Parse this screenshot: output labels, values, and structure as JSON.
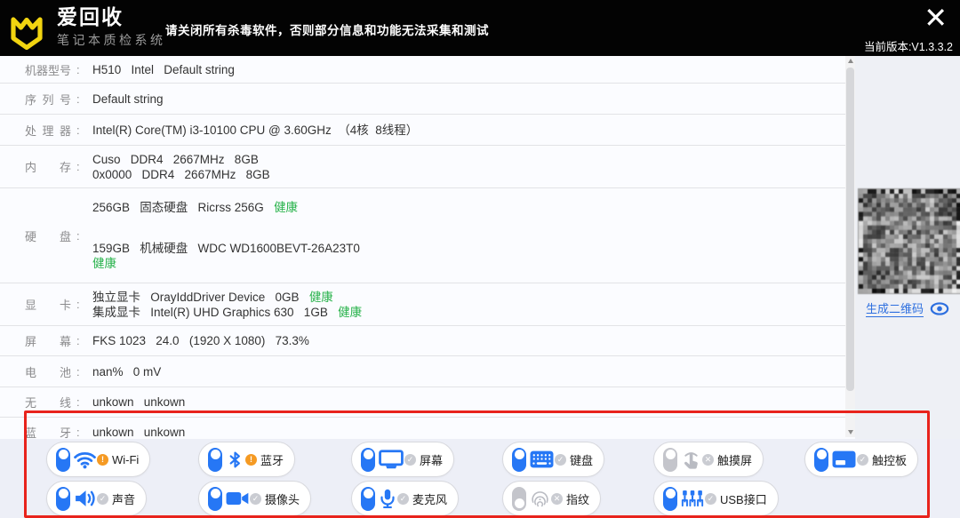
{
  "header": {
    "app_name": "爱回收",
    "app_subtitle": "笔记本质检系统",
    "warning": "请关闭所有杀毒软件，否则部分信息和功能无法采集和测试",
    "version": "当前版本:V1.3.3.2",
    "close": "✕"
  },
  "specs": [
    {
      "id": "machine",
      "label": "机器型号",
      "lines": [
        [
          {
            "t": "H510   Intel   Default string"
          }
        ]
      ]
    },
    {
      "id": "serial",
      "label": "序列号",
      "lines": [
        [
          {
            "t": "Default string"
          }
        ]
      ]
    },
    {
      "id": "cpu",
      "label": "处理器",
      "lines": [
        [
          {
            "t": "Intel(R) Core(TM) i3-10100 CPU @ 3.60GHz  （4核  8线程）"
          }
        ]
      ]
    },
    {
      "id": "memory",
      "label": "内存",
      "lines": [
        [
          {
            "t": "Cuso   DDR4   2667MHz   8GB"
          }
        ],
        [
          {
            "t": "0x0000   DDR4   2667MHz   8GB"
          }
        ]
      ]
    },
    {
      "id": "disk",
      "label": "硬盘",
      "lines": [
        [
          {
            "t": "256GB   固态硬盘   Ricrss 256G   "
          },
          {
            "t": "健康",
            "k": "health"
          }
        ],
        [
          {
            "t": "159GB   机械硬盘   WDC WD1600BEVT-26A23T0"
          }
        ],
        [
          {
            "t": "健康",
            "k": "health"
          }
        ]
      ]
    },
    {
      "id": "gpu",
      "label": "显卡",
      "lines": [
        [
          {
            "t": "独立显卡   OrayIddDriver Device   0GB   "
          },
          {
            "t": "健康",
            "k": "health"
          }
        ],
        [
          {
            "t": "集成显卡   Intel(R) UHD Graphics 630   1GB   "
          },
          {
            "t": "健康",
            "k": "health"
          }
        ]
      ]
    },
    {
      "id": "screen",
      "label": "屏幕",
      "lines": [
        [
          {
            "t": "FKS 1023   24.0   (1920 X 1080)   73.3%"
          }
        ]
      ]
    },
    {
      "id": "battery",
      "label": "电池",
      "lines": [
        [
          {
            "t": "nan%   0 mV"
          }
        ]
      ]
    },
    {
      "id": "wireless",
      "label": "无线",
      "lines": [
        [
          {
            "t": "unkown   unkown"
          }
        ]
      ]
    },
    {
      "id": "bluetooth",
      "label": "蓝牙",
      "lines": [
        [
          {
            "t": "unkown   unkown"
          }
        ]
      ]
    }
  ],
  "qr_panel": {
    "link": "生成二维码"
  },
  "toggles": [
    {
      "id": "wifi",
      "label": "Wi-Fi",
      "icon": "wifi",
      "on": true,
      "status": "warn"
    },
    {
      "id": "bluetooth",
      "label": "蓝牙",
      "icon": "bluetooth",
      "on": true,
      "status": "warn"
    },
    {
      "id": "screen",
      "label": "屏幕",
      "icon": "screen",
      "on": true,
      "status": "pass"
    },
    {
      "id": "keyboard",
      "label": "键盘",
      "icon": "keyboard",
      "on": true,
      "status": "pass"
    },
    {
      "id": "touchscreen",
      "label": "触摸屏",
      "icon": "touchscreen",
      "on": false,
      "status": "na"
    },
    {
      "id": "touchpad",
      "label": "触控板",
      "icon": "touchpad",
      "on": true,
      "status": "pass"
    },
    {
      "id": "sound",
      "label": "声音",
      "icon": "speaker",
      "on": true,
      "status": "pass"
    },
    {
      "id": "camera",
      "label": "摄像头",
      "icon": "camera",
      "on": true,
      "status": "pass"
    },
    {
      "id": "microphone",
      "label": "麦克风",
      "icon": "microphone",
      "on": true,
      "status": "pass"
    },
    {
      "id": "fingerprint",
      "label": "指纹",
      "icon": "fingerprint",
      "on": false,
      "status": "na"
    },
    {
      "id": "usb",
      "label": "USB接口",
      "icon": "usb",
      "on": true,
      "status": "pass"
    }
  ],
  "status_glyphs": {
    "warn": "!",
    "pass": "✓",
    "na": "✕"
  },
  "colors": {
    "accent_blue": "#2677f5",
    "warn_orange": "#f59a23",
    "health_green": "#27b24a",
    "brand_yellow": "#f2d410",
    "annotation_red": "#e8231c",
    "link_blue": "#2d6fdf"
  }
}
